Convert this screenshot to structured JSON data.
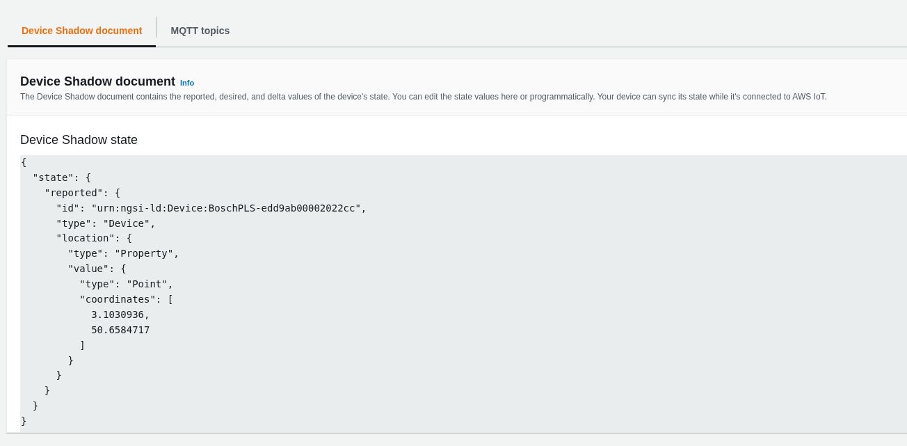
{
  "tabs": [
    {
      "label": "Device Shadow document",
      "selected": true
    },
    {
      "label": "MQTT topics",
      "selected": false
    }
  ],
  "panel": {
    "title": "Device Shadow document",
    "info_link": "Info",
    "description": "The Device Shadow document contains the reported, desired, and delta values of the device's state. You can edit the state values here or programmatically. Your device can sync its state while it's connected to AWS IoT.",
    "state_heading": "Device Shadow state",
    "code_lines": [
      "{",
      "  \"state\": {",
      "    \"reported\": {",
      "      \"id\": \"urn:ngsi-ld:Device:BoschPLS-edd9ab00002022cc\",",
      "      \"type\": \"Device\",",
      "      \"location\": {",
      "        \"type\": \"Property\",",
      "        \"value\": {",
      "          \"type\": \"Point\",",
      "          \"coordinates\": [",
      "            3.1030936,",
      "            50.6584717",
      "          ]",
      "        }",
      "      }",
      "    }",
      "  }",
      "}"
    ]
  }
}
